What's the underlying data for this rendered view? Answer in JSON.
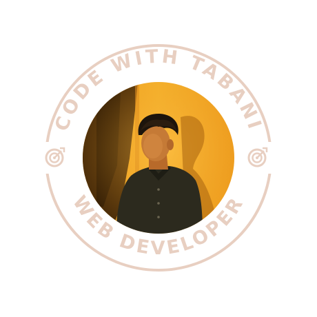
{
  "badge": {
    "top_text": "CODE WITH TABANI",
    "bottom_text": "WEB DEVELOPER",
    "photo_alt": "Portrait photo",
    "colors": {
      "ring": "#e8cfc1",
      "text": "#e8cfc1",
      "background": "#ffffff"
    },
    "icons": {
      "left": "target-icon",
      "right": "target-icon"
    }
  }
}
